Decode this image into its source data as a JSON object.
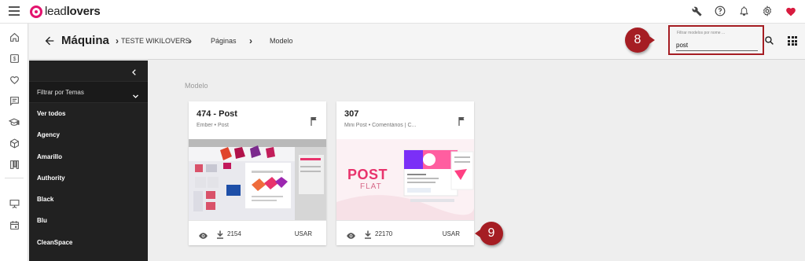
{
  "app": {
    "logo_text_light": "lead",
    "logo_text_bold": "lovers"
  },
  "header": {
    "title": "Máquina",
    "breadcrumbs": [
      "TESTE WIKILOVERS",
      "Páginas",
      "Modelo"
    ],
    "filter": {
      "placeholder": "Filtrar modelos por nome ...",
      "value": "post"
    }
  },
  "annotations": {
    "filter_step": "8",
    "use_step": "9"
  },
  "themes": {
    "filter_label": "Filtrar por Temas",
    "items": [
      "Ver todos",
      "Agency",
      "Amarillo",
      "Authority",
      "Black",
      "Blu",
      "CleanSpace"
    ]
  },
  "content": {
    "section_label": "Modelo",
    "cards": [
      {
        "title": "474 - Post",
        "subtitle": "Ember • Post",
        "downloads": "2154",
        "use_label": "USAR"
      },
      {
        "title": "307",
        "subtitle": "Mini Post • Comentários | C...",
        "downloads": "22170",
        "use_label": "USAR",
        "thumb_text_1": "POST",
        "thumb_text_2": "FLAT"
      }
    ]
  },
  "colors": {
    "brand": "#e3136e",
    "annotation": "#a51d23",
    "sidebar_bg": "#212121"
  }
}
